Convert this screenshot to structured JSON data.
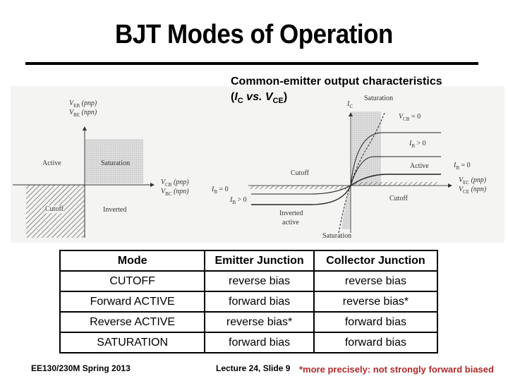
{
  "slide": {
    "title": "BJT Modes of Operation",
    "subtitle": {
      "line1": "Common-emitter output characteristics",
      "line2_prefix": "(",
      "ic_main": "I",
      "ic_sub": "C",
      "vs": " vs. ",
      "vce_main": "V",
      "vce_sub": "CE",
      "line2_suffix": ")"
    }
  },
  "left_diagram": {
    "y_axis_label_1": "(pnp)",
    "y_axis_var_1": "V",
    "y_axis_sub_1": "EB",
    "y_axis_label_2": "(npn)",
    "y_axis_var_2": "V",
    "y_axis_sub_2": "BE",
    "x_axis_var_1": "V",
    "x_axis_sub_1": "CB",
    "x_axis_label_1": "(pnp)",
    "x_axis_var_2": "V",
    "x_axis_sub_2": "BC",
    "x_axis_label_2": "(npn)",
    "regions": {
      "active": "Active",
      "saturation": "Saturation",
      "cutoff": "Cutoff",
      "inverted": "Inverted"
    }
  },
  "right_diagram": {
    "y_axis_var": "I",
    "y_axis_sub": "C",
    "saturation_top": "Saturation",
    "vcb_var": "V",
    "vcb_sub": "CB",
    "vcb_eq": " = 0",
    "ib_pos_var": "I",
    "ib_pos_sub": "B",
    "ib_pos_eq": " > 0",
    "active": "Active",
    "ib_zero_right_var": "I",
    "ib_zero_right_sub": "B",
    "ib_zero_right_eq": " = 0",
    "x_var_1": "V",
    "x_sub_1": "EC",
    "x_label_1": "(pnp)",
    "x_var_2": "V",
    "x_sub_2": "CE",
    "x_label_2": "(npn)",
    "cutoff_left": "Cutoff",
    "cutoff_right": "Cutoff",
    "ib_zero_left_var": "I",
    "ib_zero_left_sub": "B",
    "ib_zero_left_eq": " = 0",
    "ib_pos_left_var": "I",
    "ib_pos_left_sub": "B",
    "ib_pos_left_eq": " > 0",
    "inverted_1": "Inverted",
    "inverted_2": "active",
    "saturation_bottom": "Saturation"
  },
  "table": {
    "headers": [
      "Mode",
      "Emitter Junction",
      "Collector Junction"
    ],
    "rows": [
      [
        "CUTOFF",
        "reverse bias",
        "reverse bias"
      ],
      [
        "Forward ACTIVE",
        "forward bias",
        "reverse bias*"
      ],
      [
        "Reverse ACTIVE",
        "reverse bias*",
        "forward bias"
      ],
      [
        "SATURATION",
        "forward bias",
        "forward bias"
      ]
    ]
  },
  "footer": {
    "course": "EE130/230M Spring 2013",
    "lecture": "Lecture 24, Slide 9",
    "footnote": "*more precisely: not strongly forward biased",
    "footnote_color": "#b02a2a"
  }
}
